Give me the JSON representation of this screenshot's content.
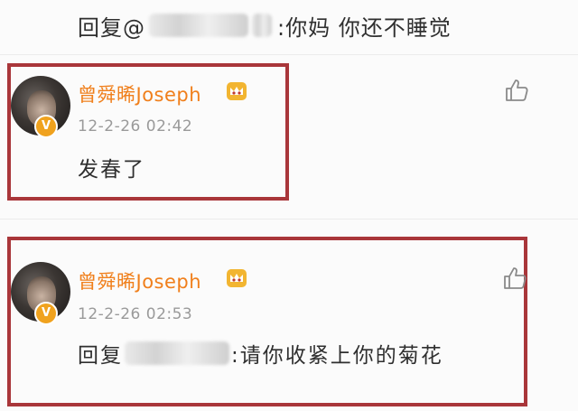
{
  "top_reply": {
    "prefix": "回复@",
    "text": ":你妈 你还不睡觉"
  },
  "comments": [
    {
      "username": "曾舜晞Joseph",
      "timestamp": "12-2-26 02:42",
      "content": "发春了",
      "badge": "V"
    },
    {
      "username": "曾舜晞Joseph",
      "timestamp": "12-2-26 02:53",
      "reply_prefix": "回复",
      "content": ":请你收紧上你的菊花",
      "badge": "V"
    }
  ],
  "colors": {
    "highlight_frame": "#a9363a",
    "username": "#f07f1b",
    "badge": "#f0a21e"
  }
}
